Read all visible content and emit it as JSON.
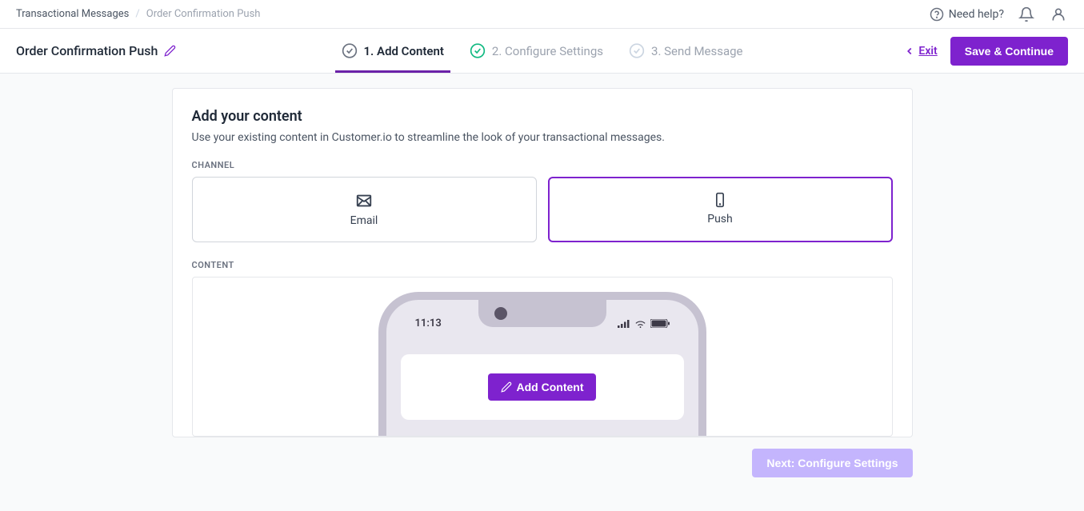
{
  "breadcrumbs": {
    "parent": "Transactional Messages",
    "current": "Order Confirmation Push"
  },
  "header": {
    "need_help": "Need help?"
  },
  "page": {
    "title": "Order Confirmation Push",
    "exit_label": "Exit",
    "save_label": "Save & Continue"
  },
  "steps": {
    "s1": "1. Add Content",
    "s2": "2. Configure Settings",
    "s3": "3. Send Message"
  },
  "card": {
    "title": "Add your content",
    "subtitle": "Use your existing content in Customer.io to streamline the look of your transactional messages."
  },
  "sections": {
    "channel_label": "CHANNEL",
    "content_label": "CONTENT"
  },
  "channels": {
    "email": "Email",
    "push": "Push"
  },
  "phone": {
    "time": "11:13"
  },
  "content": {
    "add_label": "Add Content"
  },
  "footer": {
    "next_label": "Next: Configure Settings"
  }
}
